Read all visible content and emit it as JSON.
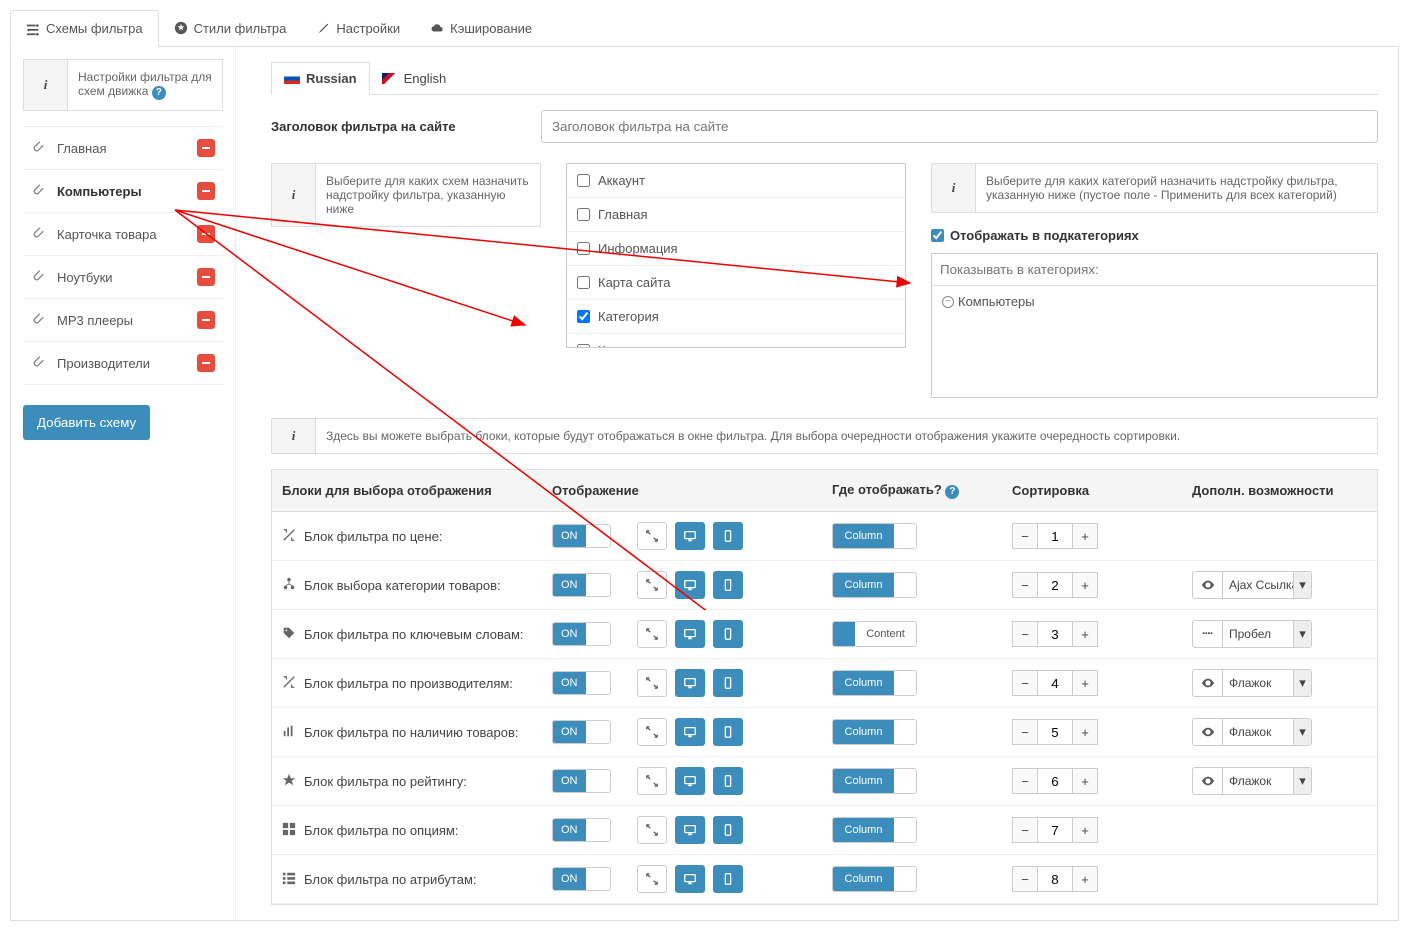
{
  "tabs": {
    "schemes": "Схемы фильтра",
    "styles": "Стили фильтра",
    "settings": "Настройки",
    "caching": "Кэширование"
  },
  "sidebar": {
    "info": "Настройки фильтра для схем движка",
    "items": [
      {
        "label": "Главная"
      },
      {
        "label": "Компьютеры",
        "active": true
      },
      {
        "label": "Карточка товара"
      },
      {
        "label": "Ноутбуки"
      },
      {
        "label": "MP3 плееры"
      },
      {
        "label": "Производители"
      }
    ],
    "add": "Добавить схему"
  },
  "langs": {
    "ru": "Russian",
    "en": "English"
  },
  "header": {
    "title_label": "Заголовок фильтра на сайте",
    "title_placeholder": "Заголовок фильтра на сайте"
  },
  "scheme_info": "Выберите для каких схем назначить надстройку фильтра, указанную ниже",
  "scheme_opts": [
    "Аккаунт",
    "Главная",
    "Информация",
    "Карта сайта",
    "Категория",
    "Контакты"
  ],
  "scheme_checked_index": 4,
  "cat_info": "Выберите для каких категорий назначить надстройку фильтра, указанную ниже (пустое поле - Применить для всех категорий)",
  "subcats_label": "Отображать в подкатегориях",
  "cat_placeholder": "Показывать в категориях:",
  "cat_tag": "Компьютеры",
  "blocks_info": "Здесь вы можете выбрать блоки, которые будут отображаться в окне фильтра. Для выбора очередности отображения укажите очередность сортировки.",
  "table": {
    "head": [
      "Блоки для выбора отображения",
      "Отображение",
      "Где отображать?",
      "Сортировка",
      "Дополн. возможности"
    ],
    "rows": [
      {
        "icon": "resize",
        "label": "Блок фильтра по цене:",
        "pos": "Column",
        "sort": "1",
        "opt": null
      },
      {
        "icon": "tree",
        "label": "Блок выбора категории товаров:",
        "pos": "Column",
        "sort": "2",
        "opt": "Ajax Ссылка",
        "eye": "eye"
      },
      {
        "icon": "tag",
        "label": "Блок фильтра по ключевым словам:",
        "pos": "Content",
        "sort": "3",
        "opt": "Пробел",
        "eye": "kbd"
      },
      {
        "icon": "resize",
        "label": "Блок фильтра по производителям:",
        "pos": "Column",
        "sort": "4",
        "opt": "Флажок",
        "eye": "eye"
      },
      {
        "icon": "stock",
        "label": "Блок фильтра по наличию товаров:",
        "pos": "Column",
        "sort": "5",
        "opt": "Флажок",
        "eye": "eye"
      },
      {
        "icon": "star",
        "label": "Блок фильтра по рейтингу:",
        "pos": "Column",
        "sort": "6",
        "opt": "Флажок",
        "eye": "eye"
      },
      {
        "icon": "grid",
        "label": "Блок фильтра по опциям:",
        "pos": "Column",
        "sort": "7",
        "opt": null
      },
      {
        "icon": "list",
        "label": "Блок фильтра по атрибутам:",
        "pos": "Column",
        "sort": "8",
        "opt": null
      }
    ],
    "on": "ON"
  }
}
